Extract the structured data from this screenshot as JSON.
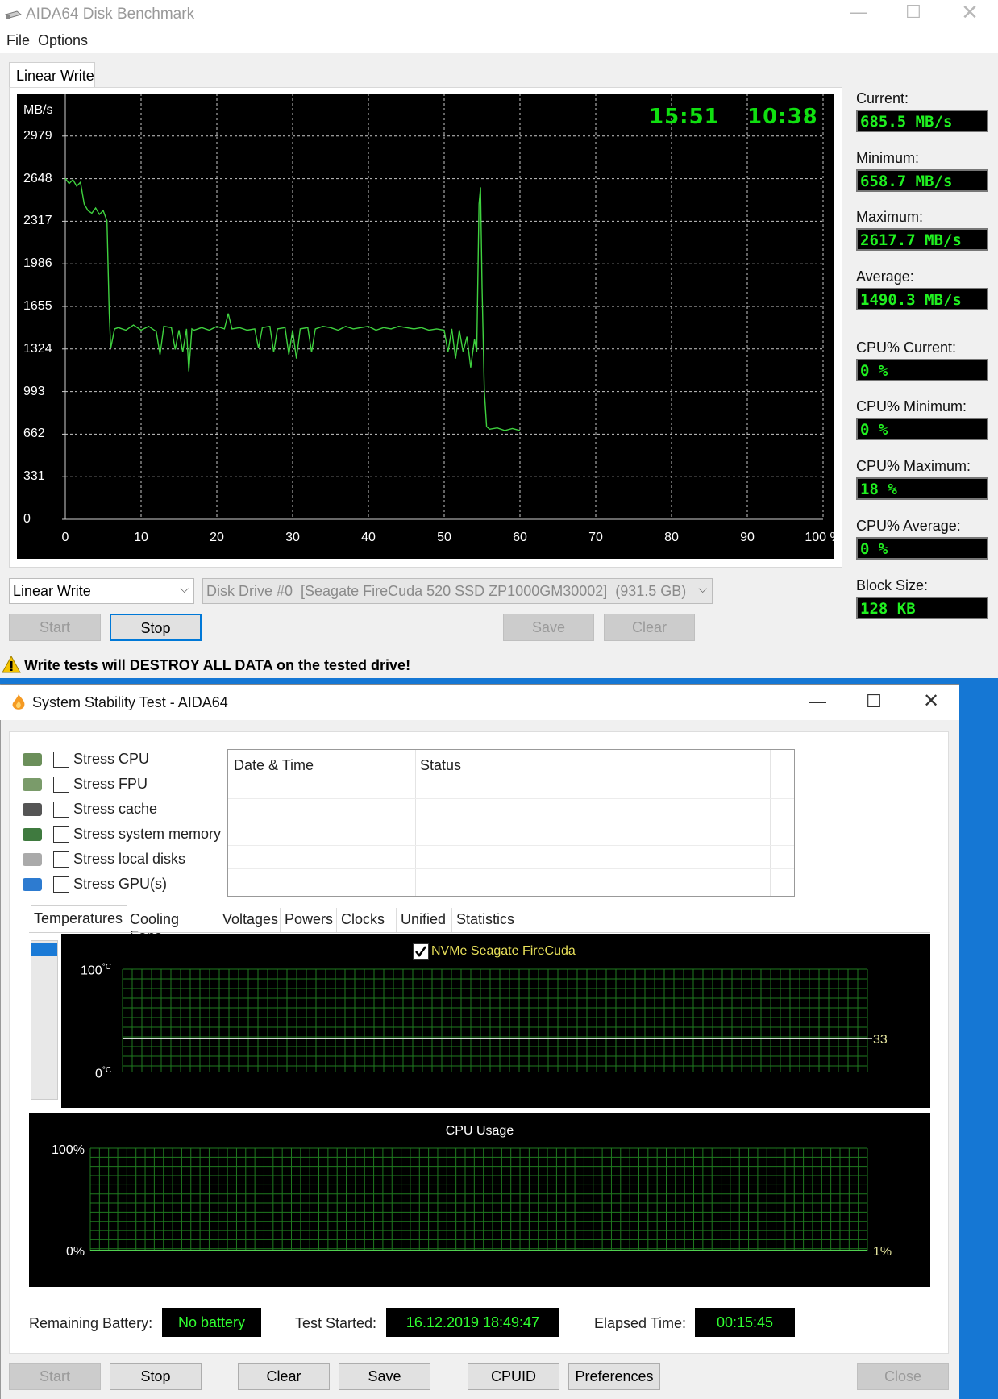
{
  "disk": {
    "title": "AIDA64 Disk Benchmark",
    "menu": [
      "File",
      "Options"
    ],
    "tab": "Linear Write",
    "chart_data": {
      "type": "line",
      "ylabel": "MB/s",
      "y_ticks": [
        "2979",
        "2648",
        "2317",
        "1986",
        "1655",
        "1324",
        "993",
        "662",
        "331",
        "0"
      ],
      "x_ticks": [
        "0",
        "10",
        "20",
        "30",
        "40",
        "50",
        "60",
        "70",
        "80",
        "90",
        "100 %"
      ],
      "ylim": [
        0,
        3310
      ],
      "xlim": [
        0,
        100
      ],
      "grid": true,
      "time_elapsed": "15:51",
      "time_remaining": "10:38",
      "series": [
        {
          "points": [
            [
              0,
              2650
            ],
            [
              0.5,
              2610
            ],
            [
              1,
              2640
            ],
            [
              1.5,
              2590
            ],
            [
              2,
              2620
            ],
            [
              2.5,
              2450
            ],
            [
              3,
              2400
            ],
            [
              3.5,
              2380
            ],
            [
              4,
              2420
            ],
            [
              4.5,
              2370
            ],
            [
              5,
              2400
            ],
            [
              5.5,
              2320
            ],
            [
              5.8,
              1600
            ],
            [
              6,
              1330
            ],
            [
              6.5,
              1480
            ],
            [
              7,
              1490
            ],
            [
              8,
              1470
            ],
            [
              9,
              1510
            ],
            [
              10,
              1470
            ],
            [
              11,
              1500
            ],
            [
              12,
              1460
            ],
            [
              12.5,
              1280
            ],
            [
              13,
              1500
            ],
            [
              14,
              1490
            ],
            [
              14.5,
              1320
            ],
            [
              15,
              1470
            ],
            [
              15.5,
              1300
            ],
            [
              16,
              1480
            ],
            [
              16.3,
              1150
            ],
            [
              16.7,
              1480
            ],
            [
              17,
              1470
            ],
            [
              18,
              1490
            ],
            [
              19,
              1470
            ],
            [
              20,
              1500
            ],
            [
              21,
              1480
            ],
            [
              21.5,
              1600
            ],
            [
              22,
              1480
            ],
            [
              23,
              1490
            ],
            [
              24,
              1470
            ],
            [
              25,
              1480
            ],
            [
              25.5,
              1330
            ],
            [
              26,
              1490
            ],
            [
              27,
              1500
            ],
            [
              27.5,
              1300
            ],
            [
              28,
              1480
            ],
            [
              29,
              1490
            ],
            [
              29.5,
              1280
            ],
            [
              30,
              1470
            ],
            [
              30.5,
              1250
            ],
            [
              31,
              1480
            ],
            [
              32,
              1490
            ],
            [
              32.5,
              1300
            ],
            [
              33,
              1480
            ],
            [
              34,
              1500
            ],
            [
              35,
              1490
            ],
            [
              36,
              1470
            ],
            [
              37,
              1500
            ],
            [
              38,
              1480
            ],
            [
              39,
              1490
            ],
            [
              40,
              1500
            ],
            [
              41,
              1470
            ],
            [
              42,
              1490
            ],
            [
              43,
              1480
            ],
            [
              44,
              1500
            ],
            [
              45,
              1490
            ],
            [
              46,
              1480
            ],
            [
              47,
              1490
            ],
            [
              48,
              1470
            ],
            [
              49,
              1480
            ],
            [
              50,
              1470
            ],
            [
              50.5,
              1300
            ],
            [
              51,
              1480
            ],
            [
              51.5,
              1250
            ],
            [
              52,
              1470
            ],
            [
              52.5,
              1300
            ],
            [
              53,
              1420
            ],
            [
              53.5,
              1180
            ],
            [
              54,
              1400
            ],
            [
              54.3,
              1300
            ],
            [
              54.6,
              2450
            ],
            [
              54.8,
              2580
            ],
            [
              55,
              1800
            ],
            [
              55.3,
              1000
            ],
            [
              55.6,
              720
            ],
            [
              56,
              700
            ],
            [
              57,
              710
            ],
            [
              58,
              690
            ],
            [
              59,
              705
            ],
            [
              60,
              690
            ]
          ]
        }
      ]
    },
    "stats": [
      {
        "label": "Current:",
        "value": "685.5 MB/s"
      },
      {
        "label": "Minimum:",
        "value": "658.7 MB/s"
      },
      {
        "label": "Maximum:",
        "value": "2617.7 MB/s"
      },
      {
        "label": "Average:",
        "value": "1490.3 MB/s"
      },
      {
        "label": "CPU% Current:",
        "value": "0 %"
      },
      {
        "label": "CPU% Minimum:",
        "value": "0 %"
      },
      {
        "label": "CPU% Maximum:",
        "value": "18 %"
      },
      {
        "label": "CPU% Average:",
        "value": "0 %"
      },
      {
        "label": "Block Size:",
        "value": "128 KB"
      }
    ],
    "test_select": "Linear Write",
    "drive_select": "Disk Drive #0  [Seagate FireCuda 520 SSD ZP1000GM30002]  (931.5 GB)",
    "buttons": {
      "start": "Start",
      "stop": "Stop",
      "save": "Save",
      "clear": "Clear"
    },
    "warning": "Write tests will DESTROY ALL DATA on the tested drive!"
  },
  "stability": {
    "title": "System Stability Test - AIDA64",
    "stress": [
      {
        "label": "Stress CPU",
        "icon": "cpu-icon"
      },
      {
        "label": "Stress FPU",
        "icon": "fpu-icon"
      },
      {
        "label": "Stress cache",
        "icon": "cache-icon"
      },
      {
        "label": "Stress system memory",
        "icon": "memory-icon"
      },
      {
        "label": "Stress local disks",
        "icon": "disk-icon"
      },
      {
        "label": "Stress GPU(s)",
        "icon": "gpu-icon"
      }
    ],
    "log_headers": [
      "Date & Time",
      "Status"
    ],
    "tabs": [
      "Temperatures",
      "Cooling Fans",
      "Voltages",
      "Powers",
      "Clocks",
      "Unified",
      "Statistics"
    ],
    "temp_graph": {
      "legend": "NVMe Seagate FireCuda",
      "ymax": "100",
      "ymin": "0",
      "unit": "°C",
      "value": "33",
      "value_num": 33
    },
    "cpu_graph": {
      "title": "CPU Usage",
      "ymax": "100%",
      "ymin": "0%",
      "value": "1%",
      "value_num": 1
    },
    "status": {
      "battery_label": "Remaining Battery:",
      "battery": "No battery",
      "started_label": "Test Started:",
      "started": "16.12.2019 18:49:47",
      "elapsed_label": "Elapsed Time:",
      "elapsed": "00:15:45"
    },
    "buttons": {
      "start": "Start",
      "stop": "Stop",
      "clear": "Clear",
      "save": "Save",
      "cpuid": "CPUID",
      "preferences": "Preferences",
      "close": "Close"
    }
  }
}
